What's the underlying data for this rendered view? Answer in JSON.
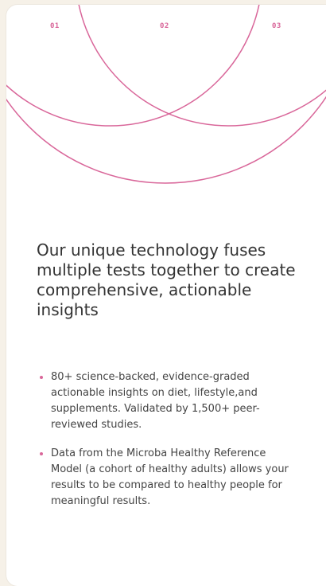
{
  "labels": {
    "one": "01",
    "two": "02",
    "three": "03"
  },
  "headline": "Our unique technology fuses multiple tests together to create comprehensive, actionable insights",
  "bullets": [
    "80+ science-backed, evidence-graded actionable insights on diet, lifestyle,and supplements. Validated by 1,500+ peer-reviewed studies.",
    "Data from the Microba Healthy Reference Model (a cohort of healthy adults) allows your results to be compared to healthy people for meaningful results."
  ],
  "colors": {
    "accent": "#d9679a",
    "background": "#f6f1e8",
    "card": "#ffffff",
    "text": "#333333"
  }
}
